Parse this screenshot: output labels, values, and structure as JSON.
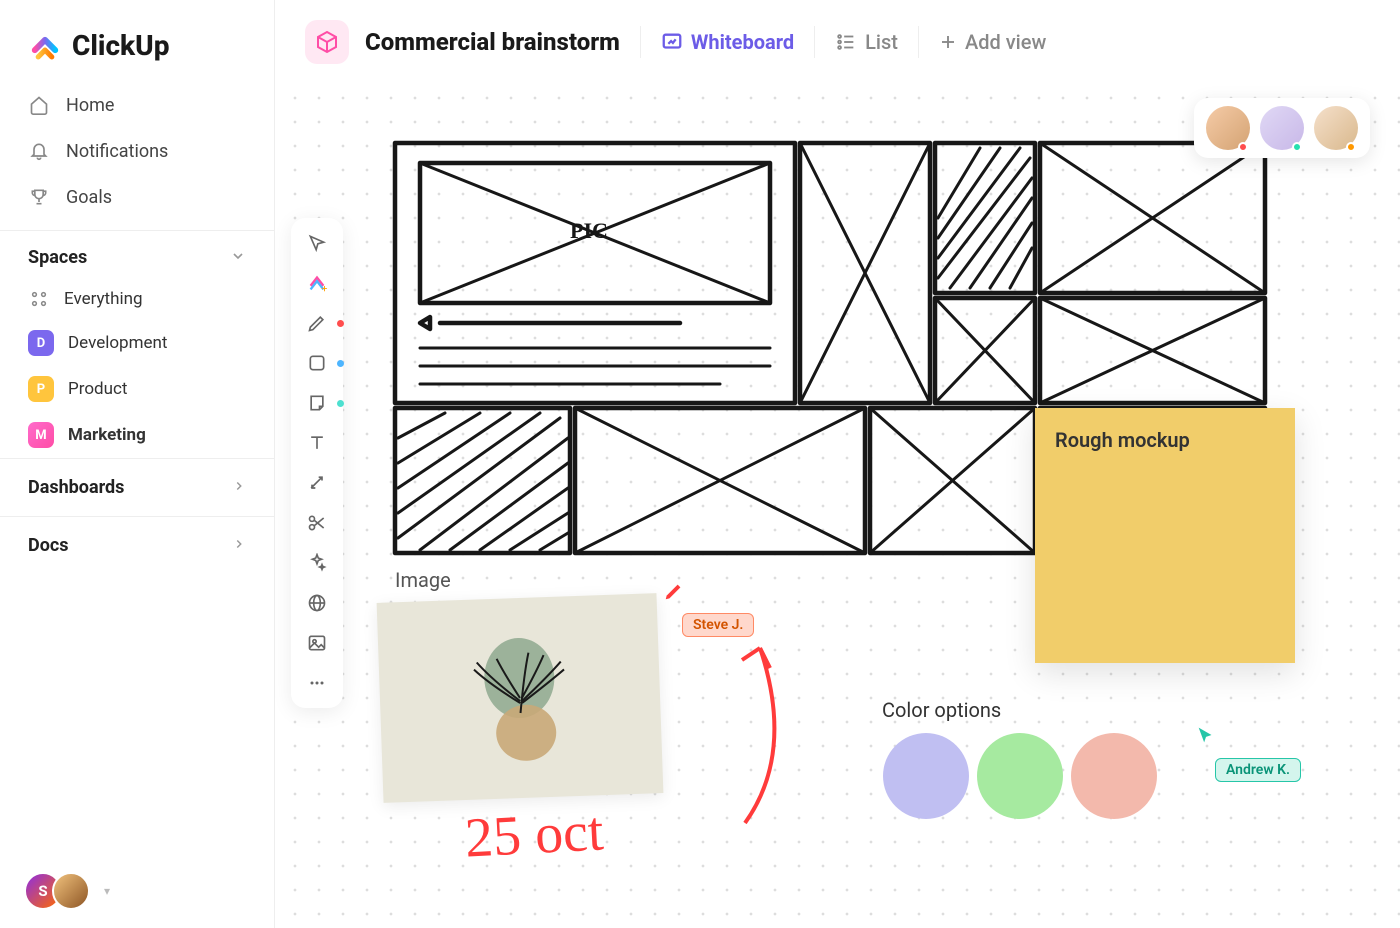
{
  "brand": "ClickUp",
  "nav": {
    "home": "Home",
    "notifications": "Notifications",
    "goals": "Goals"
  },
  "spaces": {
    "title": "Spaces",
    "everything": "Everything",
    "items": [
      {
        "badge": "D",
        "label": "Development"
      },
      {
        "badge": "P",
        "label": "Product"
      },
      {
        "badge": "M",
        "label": "Marketing"
      }
    ]
  },
  "sections": {
    "dashboards": "Dashboards",
    "docs": "Docs"
  },
  "user_badge": "S",
  "topbar": {
    "project_title": "Commercial brainstorm",
    "views": {
      "whiteboard": "Whiteboard",
      "list": "List",
      "add": "Add view"
    }
  },
  "canvas": {
    "sketch_label": "PIC",
    "sticky_note": "Rough mockup",
    "image_label": "Image",
    "date_text": "25 oct",
    "color_options_label": "Color options",
    "color_swatches": [
      "#c0bff2",
      "#a6eaa0",
      "#f3b9ac"
    ],
    "cursors": {
      "steve": "Steve J.",
      "andrew": "Andrew K."
    }
  },
  "presence": {
    "users": [
      "user-1",
      "user-2",
      "user-3"
    ],
    "status_colors": [
      "#ff4d4d",
      "#26e0b0",
      "#ff9800"
    ]
  },
  "tools": [
    "cursor",
    "add-element",
    "pen",
    "shape",
    "sticky",
    "text",
    "connector",
    "scissors",
    "ai",
    "web",
    "image",
    "more"
  ]
}
